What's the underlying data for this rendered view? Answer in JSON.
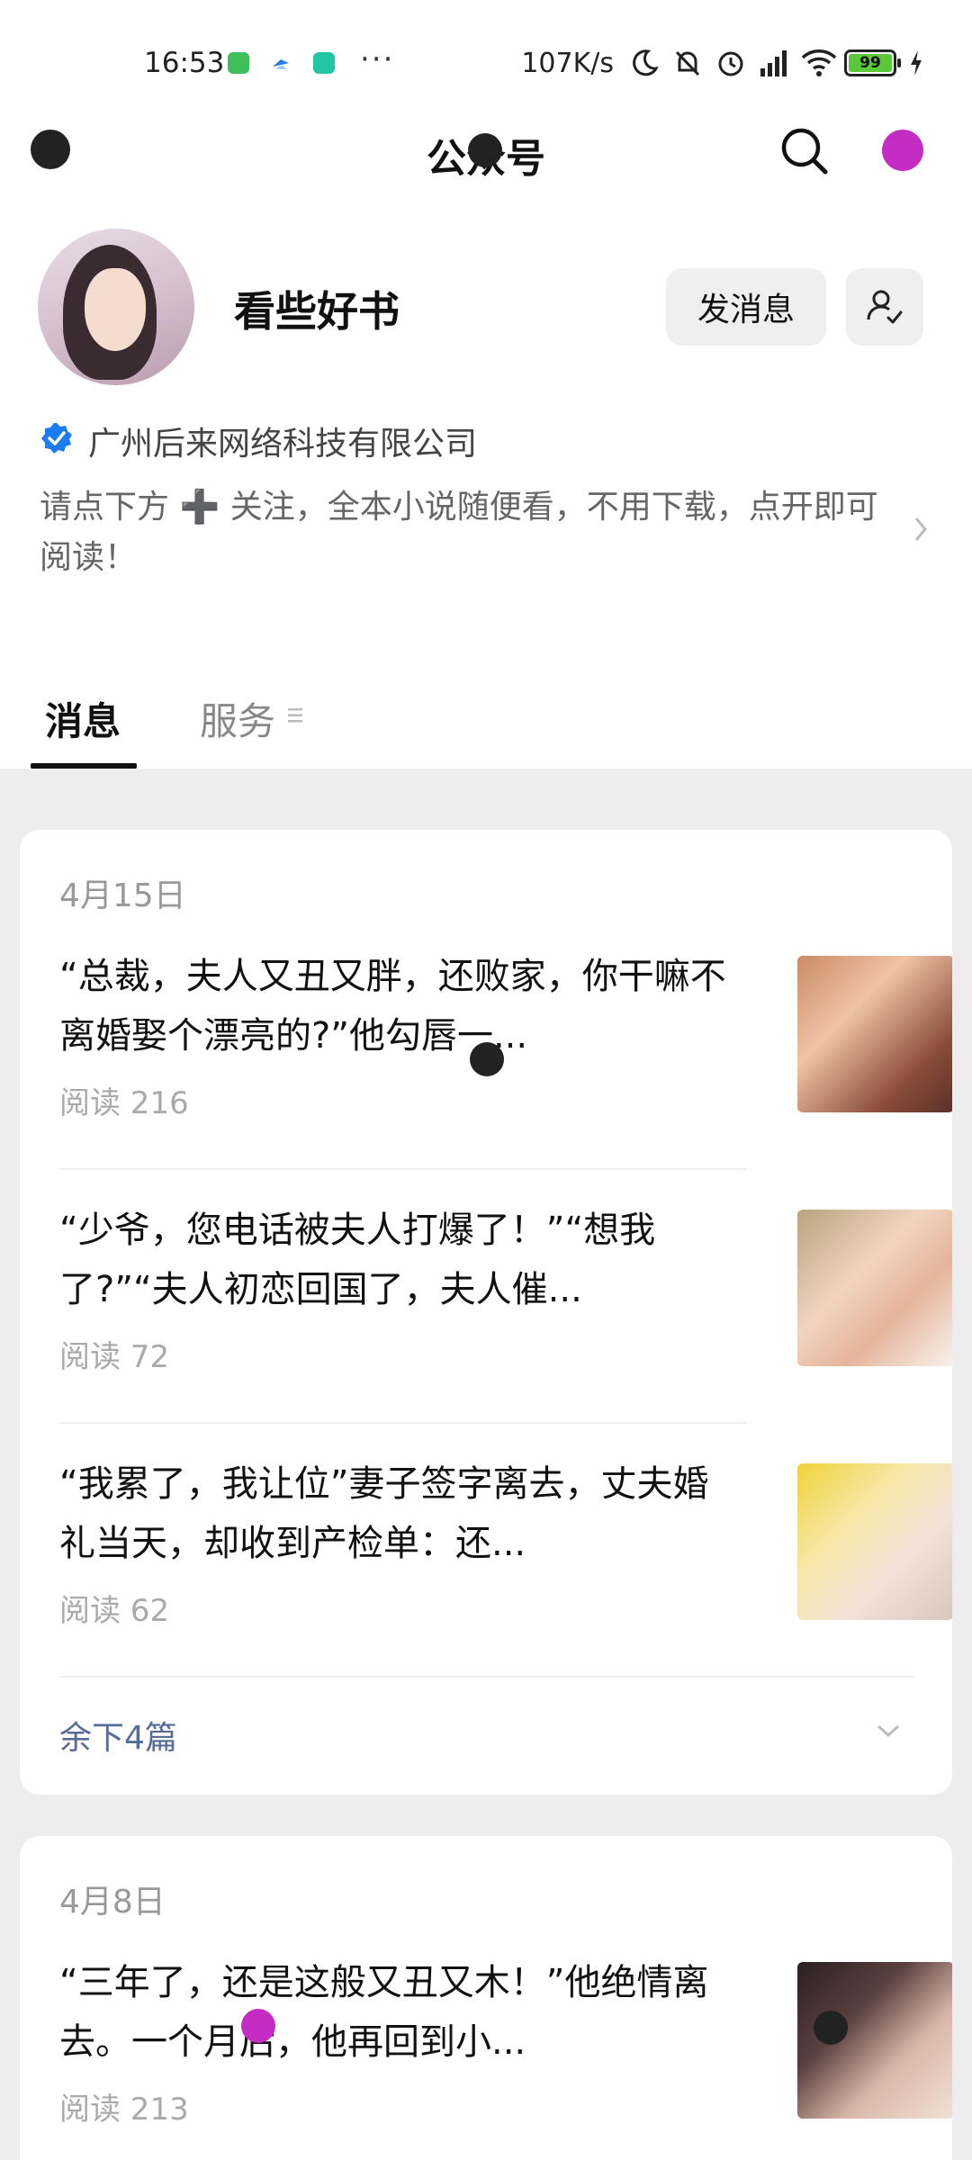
{
  "status_bar": {
    "time": "16:53",
    "network_speed": "107K/s",
    "battery": "99",
    "icons": [
      "app-notification-icon",
      "bird-app-icon",
      "shield-app-icon",
      "moon-icon",
      "silent-bell-icon",
      "alarm-icon",
      "signal-icon",
      "wifi-icon",
      "battery-icon",
      "charging-icon"
    ]
  },
  "nav": {
    "title": "公众号"
  },
  "profile": {
    "name": "看些好书",
    "message_button": "发消息",
    "company": "广州后来网络科技有限公司",
    "description": "请点下方 ➕ 关注，全本小说随便看，不用下载，点开即可阅读！"
  },
  "tabs": [
    {
      "label": "消息"
    },
    {
      "label": "服务"
    }
  ],
  "feed": [
    {
      "date": "4月15日",
      "articles": [
        {
          "title": "“总裁，夫人又丑又胖，还败家，你干嘛不离婚娶个漂亮的?”他勾唇一...",
          "reads": "阅读 216"
        },
        {
          "title": "“少爷，您电话被夫人打爆了！”“想我了?”“夫人初恋回国了，夫人催...",
          "reads": "阅读 72"
        },
        {
          "title": "“我累了，我让位”妻子签字离去，丈夫婚礼当天，却收到产检单：还...",
          "reads": "阅读 62"
        }
      ],
      "more": "余下4篇"
    },
    {
      "date": "4月8日",
      "articles": [
        {
          "title": "“三年了，还是这般又丑又木！”他绝情离去。一个月后，他再回到小...",
          "reads": "阅读 213"
        }
      ]
    }
  ],
  "colors": {
    "accent_link": "#576b95",
    "verified_blue": "#1e7cf2",
    "feed_background": "#ededed"
  }
}
